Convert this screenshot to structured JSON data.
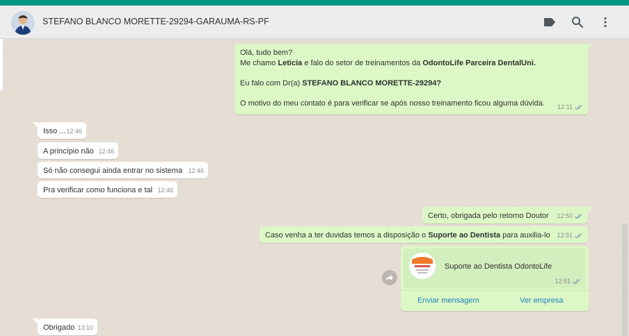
{
  "header": {
    "contact_name": "STEFANO BLANCO MORETTE-29294-GARAUMA-RS-PF",
    "icons": [
      "label-icon",
      "search-icon",
      "menu-icon"
    ]
  },
  "messages": {
    "m1": {
      "line1": "Olá, tudo bem?",
      "line2_pre": "Me chamo ",
      "line2_name": "Leticia",
      "line2_mid": " e falo do setor de treinamentos  da ",
      "line2_company": "OdontoLife Parceira DentalUni.",
      "line3_pre": " Eu falo com Dr(a) ",
      "line3_doctor": "STEFANO BLANCO MORETTE-29294?",
      "line4": "O motivo do meu contato é para verificar se após nosso treinamento ficou alguma dúvida.",
      "time": "12:11"
    },
    "m2": {
      "text": "Isso ...",
      "time": "12:46"
    },
    "m3": {
      "text": "A princípio não",
      "time": "12:46"
    },
    "m4": {
      "text": "Só não consegui ainda entrar no sistema",
      "time": "12:46"
    },
    "m5": {
      "text": "Pra verificar como funciona e tal",
      "time": "12:46"
    },
    "m6": {
      "text": "Certo, obrigada pelo retorno Doutor",
      "time": "12:50"
    },
    "m7": {
      "pre": "Caso venha a ter duvidas temos a disposição o ",
      "bold": "Suporte ao Dentista",
      "post": " para auxilia-lo",
      "time": "12:51"
    },
    "m8": {
      "card_title": "Suporte ao Dentista OdontoLife",
      "time": "12:51",
      "action_message": "Enviar mensagem",
      "action_company": "Ver empresa"
    },
    "m9": {
      "text": "Obrigado",
      "time": "13:10"
    }
  },
  "colors": {
    "accent": "#009688",
    "outgoing_bubble": "#dcf8c6",
    "incoming_bubble": "#ffffff",
    "read_ticks": "#4fc3f7"
  }
}
